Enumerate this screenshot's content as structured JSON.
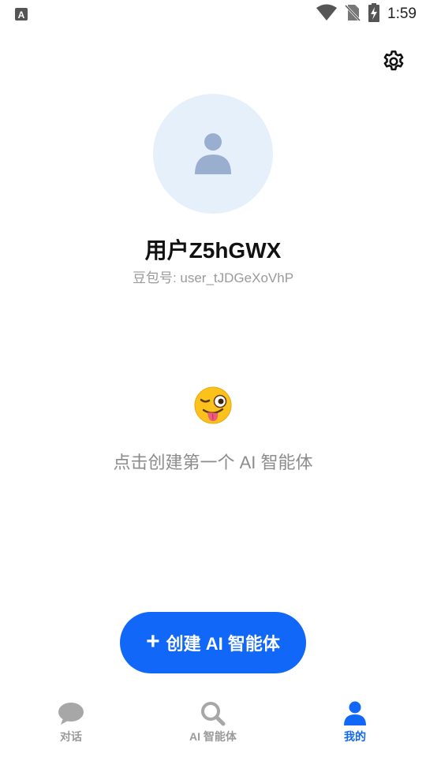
{
  "status_bar": {
    "time": "1:59",
    "notification_icon": "a-icon",
    "wifi_icon": "wifi-icon",
    "sim_icon": "no-sim-icon",
    "battery_icon": "battery-charging-icon"
  },
  "header": {
    "settings_icon": "gear-icon"
  },
  "profile": {
    "username": "用户Z5hGWX",
    "user_id": "豆包号: user_tJDGeXoVhP",
    "avatar_icon": "user-placeholder-icon"
  },
  "empty_state": {
    "emoji": "winking-face-tongue",
    "text": "点击创建第一个 AI 智能体"
  },
  "create_button": {
    "plus": "+",
    "label": "创建 AI 智能体"
  },
  "bottom_nav": {
    "items": [
      {
        "label": "对话",
        "icon": "chat-bubble-icon",
        "active": false
      },
      {
        "label": "AI 智能体",
        "icon": "search-icon",
        "active": false
      },
      {
        "label": "我的",
        "icon": "person-icon",
        "active": true
      }
    ]
  },
  "colors": {
    "accent": "#1167f7",
    "avatar_bg": "#e6f0fb",
    "inactive": "#a7a7a7"
  }
}
